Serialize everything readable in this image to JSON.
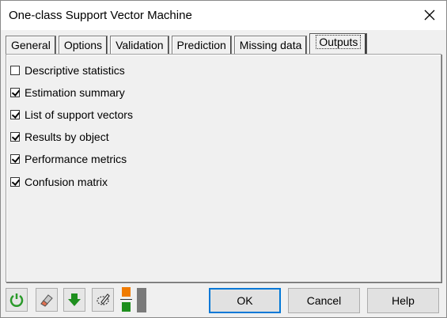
{
  "window": {
    "title": "One-class Support Vector Machine"
  },
  "tabs": [
    {
      "label": "General",
      "active": false
    },
    {
      "label": "Options",
      "active": false
    },
    {
      "label": "Validation",
      "active": false
    },
    {
      "label": "Prediction",
      "active": false
    },
    {
      "label": "Missing data",
      "active": false
    },
    {
      "label": "Outputs",
      "active": true
    }
  ],
  "outputs": [
    {
      "label": "Descriptive statistics",
      "checked": false
    },
    {
      "label": "Estimation summary",
      "checked": true
    },
    {
      "label": "List of support vectors",
      "checked": true
    },
    {
      "label": "Results by object",
      "checked": true
    },
    {
      "label": "Performance metrics",
      "checked": true
    },
    {
      "label": "Confusion matrix",
      "checked": true
    }
  ],
  "toolbar": {
    "icons": [
      "reset-icon",
      "eraser-icon",
      "download-arrow-icon",
      "pen-selection-icon"
    ],
    "colors": {
      "reset": "#2a9a2a",
      "download": "#1e8f1e",
      "orange": "#f07b00",
      "green": "#1e8f1e",
      "gray": "#7a7a7a"
    }
  },
  "buttons": {
    "ok": "OK",
    "cancel": "Cancel",
    "help": "Help"
  }
}
